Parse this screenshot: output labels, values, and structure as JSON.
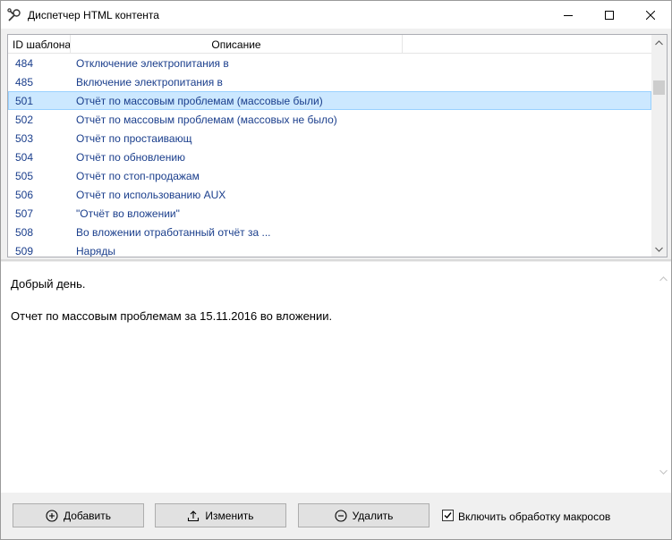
{
  "window": {
    "title": "Диспетчер HTML контента",
    "icon": "wrench-icon"
  },
  "list": {
    "columns": [
      "ID шаблона",
      "Описание"
    ],
    "rows": [
      {
        "id": "484",
        "desc": "Отключение электропитания в"
      },
      {
        "id": "485",
        "desc": "Включение электропитания в"
      },
      {
        "id": "501",
        "desc": "Отчёт по массовым проблемам (массовые были)",
        "selected": true
      },
      {
        "id": "502",
        "desc": "Отчёт по массовым проблемам (массовых не было)"
      },
      {
        "id": "503",
        "desc": "Отчёт по простаивающ"
      },
      {
        "id": "504",
        "desc": "Отчёт по обновлению"
      },
      {
        "id": "505",
        "desc": "Отчёт по стоп-продажам"
      },
      {
        "id": "506",
        "desc": "Отчёт по использованию AUX"
      },
      {
        "id": "507",
        "desc": "\"Отчёт во вложении\""
      },
      {
        "id": "508",
        "desc": "Во вложении отработанный отчёт за ..."
      },
      {
        "id": "509",
        "desc": "Наряды"
      }
    ]
  },
  "preview": {
    "line1": "Добрый день.",
    "line2_prefix": "Отчет по массовым проблемам за ",
    "line2_date": "15.11.2016",
    "line2_suffix": " во вложении."
  },
  "buttons": {
    "add_label": "Добавить",
    "edit_label": "Изменить",
    "delete_label": "Удалить"
  },
  "macro_checkbox": {
    "label": "Включить обработку макросов",
    "checked": true
  },
  "colors": {
    "selection_bg": "#cce8ff",
    "row_text": "#1a3e8c"
  }
}
